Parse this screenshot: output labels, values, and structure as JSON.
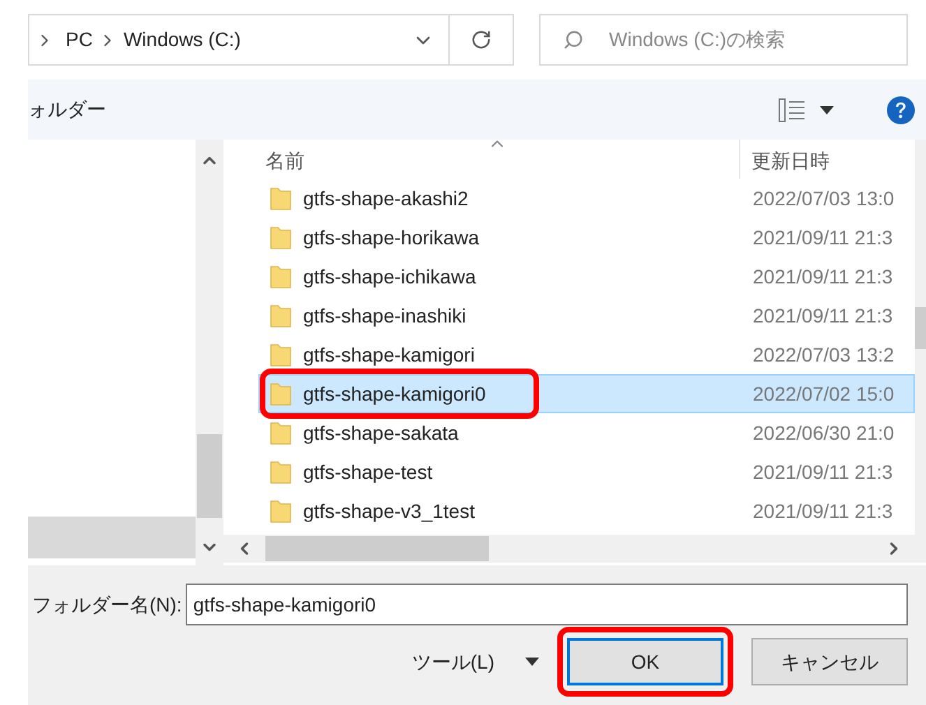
{
  "address_bar": {
    "path": [
      "PC",
      "Windows (C:)"
    ]
  },
  "search": {
    "placeholder": "Windows (C:)の検索"
  },
  "toolbar": {
    "new_folder": "ォルダー"
  },
  "file_list": {
    "columns": [
      {
        "label": "名前",
        "sorted": true
      },
      {
        "label": "更新日時",
        "sorted": false
      }
    ],
    "rows": [
      {
        "name": "gtfs-shape-akashi2",
        "modified": "2022/07/03 13:0",
        "selected": false,
        "highlighted": false
      },
      {
        "name": "gtfs-shape-horikawa",
        "modified": "2021/09/11 21:3",
        "selected": false,
        "highlighted": false
      },
      {
        "name": "gtfs-shape-ichikawa",
        "modified": "2021/09/11 21:3",
        "selected": false,
        "highlighted": false
      },
      {
        "name": "gtfs-shape-inashiki",
        "modified": "2021/09/11 21:3",
        "selected": false,
        "highlighted": false
      },
      {
        "name": "gtfs-shape-kamigori",
        "modified": "2022/07/03 13:2",
        "selected": false,
        "highlighted": false
      },
      {
        "name": "gtfs-shape-kamigori0",
        "modified": "2022/07/02 15:0",
        "selected": true,
        "highlighted": true
      },
      {
        "name": "gtfs-shape-sakata",
        "modified": "2022/06/30 21:0",
        "selected": false,
        "highlighted": false
      },
      {
        "name": "gtfs-shape-test",
        "modified": "2021/09/11 21:3",
        "selected": false,
        "highlighted": false
      },
      {
        "name": "gtfs-shape-v3_1test",
        "modified": "2021/09/11 21:3",
        "selected": false,
        "highlighted": false
      }
    ]
  },
  "footer": {
    "folder_name_label": "フォルダー名(N):",
    "folder_name_value": "gtfs-shape-kamigori0",
    "tools": "ツール(L)",
    "buttons": [
      {
        "label": "OK",
        "default": true,
        "highlighted": true
      },
      {
        "label": "キャンセル",
        "default": false,
        "highlighted": false
      }
    ]
  }
}
